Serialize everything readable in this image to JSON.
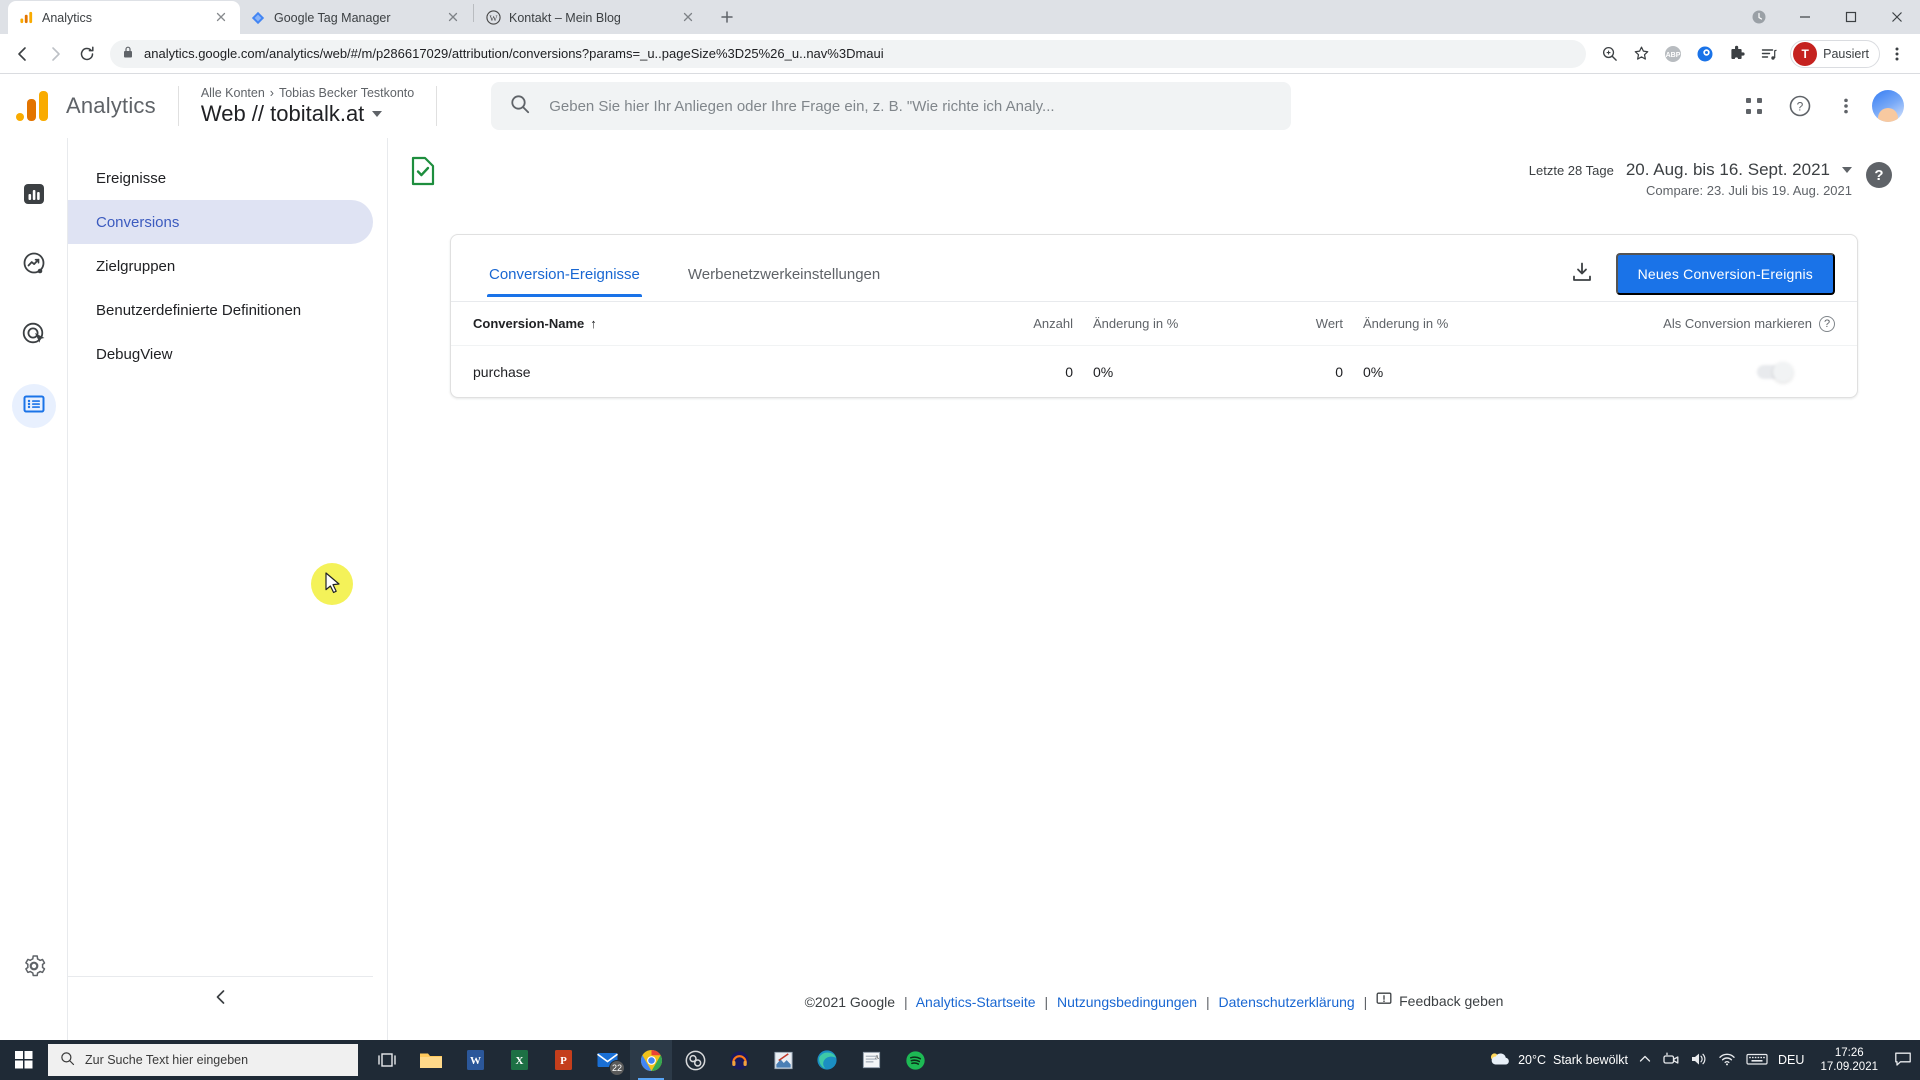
{
  "browser": {
    "tabs": [
      {
        "title": "Analytics",
        "favicon": "analytics-icon",
        "active": true
      },
      {
        "title": "Google Tag Manager",
        "favicon": "tag-manager-icon",
        "active": false
      },
      {
        "title": "Kontakt – Mein Blog",
        "favicon": "wordpress-icon",
        "active": false
      }
    ],
    "new_tab_label": "+",
    "url": "analytics.google.com/analytics/web/#/m/p286617029/attribution/conversions?params=_u..pageSize%3D25%26_u..nav%3Dmaui",
    "url_domain": "analytics.google.com",
    "url_path": "/analytics/web/#/m/p286617029/attribution/conversions?params=_u..pageSize%3D25%26_u..nav%3Dmaui",
    "profile_label": "Pausiert",
    "profile_initial": "T",
    "extensions": [
      "adblock-plus-icon",
      "blue-extension-icon",
      "puzzle-extensions-icon",
      "reading-list-icon"
    ]
  },
  "ga_header": {
    "product_name": "Analytics",
    "breadcrumb_root": "Alle Konten",
    "breadcrumb_separator": "›",
    "breadcrumb_account": "Tobias Becker Testkonto",
    "property_title": "Web // tobitalk.at",
    "search_placeholder": "Geben Sie hier Ihr Anliegen oder Ihre Frage ein, z. B. \"Wie richte ich Analy..."
  },
  "rail": {
    "items": [
      {
        "name": "berichte",
        "icon": "bar-chart-icon",
        "active": false
      },
      {
        "name": "explorative-datenanalyse",
        "icon": "trend-bubble-icon",
        "active": false
      },
      {
        "name": "werbung",
        "icon": "target-click-icon",
        "active": false
      },
      {
        "name": "konfigurieren",
        "icon": "list-config-icon",
        "active": true
      }
    ],
    "settings_icon": "gear-icon"
  },
  "sidebar": {
    "items": [
      {
        "label": "Ereignisse",
        "active": false
      },
      {
        "label": "Conversions",
        "active": true
      },
      {
        "label": "Zielgruppen",
        "active": false
      },
      {
        "label": "Benutzerdefinierte Definitionen",
        "active": false
      },
      {
        "label": "DebugView",
        "active": false
      }
    ],
    "collapse_icon": "chevron-left-icon"
  },
  "date_bar": {
    "preset_label": "Letzte 28 Tage",
    "range_label": "20. Aug. bis 16. Sept. 2021",
    "compare_label": "Compare: 23. Juli bis 19. Aug. 2021",
    "help_glyph": "?"
  },
  "card": {
    "tabs": [
      {
        "label": "Conversion-Ereignisse",
        "active": true
      },
      {
        "label": "Werbenetzwerkeinstellungen",
        "active": false
      }
    ],
    "download_icon": "download-icon",
    "new_conversion_button": "Neues Conversion-Ereignis",
    "table": {
      "headers": {
        "name": "Conversion-Name",
        "sort_arrow": "↑",
        "count": "Anzahl",
        "count_change": "Änderung in %",
        "value": "Wert",
        "value_change": "Änderung in %",
        "mark": "Als Conversion markieren",
        "mark_help": "?"
      },
      "rows": [
        {
          "name": "purchase",
          "count": "0",
          "count_change": "0%",
          "value": "0",
          "value_change": "0%",
          "mark_on": false
        }
      ]
    }
  },
  "footer": {
    "copyright": "©2021 Google",
    "links": [
      "Analytics-Startseite",
      "Nutzungsbedingungen",
      "Datenschutzerklärung"
    ],
    "feedback": "Feedback geben",
    "separator": "|"
  },
  "taskbar": {
    "search_placeholder": "Zur Suche Text hier eingeben",
    "apps": [
      {
        "name": "task-view-icon"
      },
      {
        "name": "file-explorer-icon"
      },
      {
        "name": "word-icon"
      },
      {
        "name": "excel-icon"
      },
      {
        "name": "powerpoint-icon"
      },
      {
        "name": "mail-icon",
        "badge": "22"
      },
      {
        "name": "chrome-icon",
        "active": true
      },
      {
        "name": "obs-icon"
      },
      {
        "name": "headphones-icon"
      },
      {
        "name": "photo-editor-icon"
      },
      {
        "name": "edge-icon"
      },
      {
        "name": "notepad-icon"
      },
      {
        "name": "spotify-icon"
      }
    ],
    "weather_temp": "20°C",
    "weather_text": "Stark bewölkt",
    "language": "DEU",
    "time": "17:26",
    "date": "17.09.2021"
  },
  "colors": {
    "accent_blue": "#1a73e8",
    "link_blue": "#1967d2",
    "sidebar_active_bg": "#dfe3f3",
    "sidebar_active_fg": "#3c5bbf",
    "ga_orange": "#e37400",
    "ga_yellow": "#f9ab00",
    "taskbar_bg": "#1f2a36"
  }
}
